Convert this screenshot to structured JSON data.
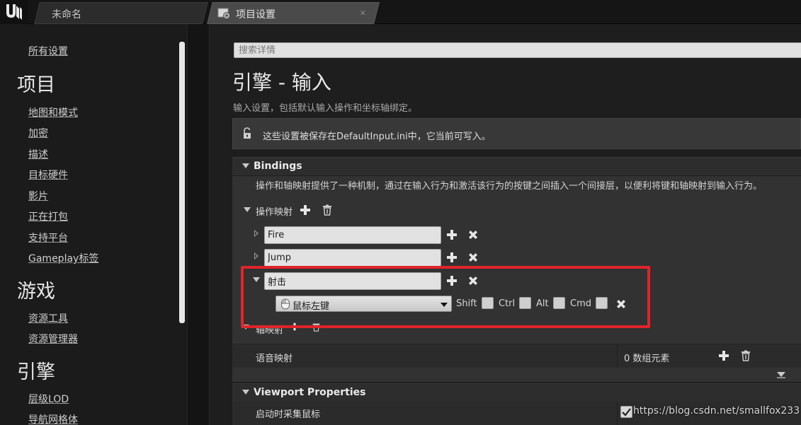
{
  "tabs": {
    "untitled": "未命名",
    "settings": "项目设置"
  },
  "nav": {
    "all_settings": "所有设置",
    "project_head": "项目",
    "project_items": [
      "地图和模式",
      "加密",
      "描述",
      "目标硬件",
      "影片",
      "正在打包",
      "支持平台",
      "Gameplay标签"
    ],
    "game_head": "游戏",
    "game_items": [
      "资源工具",
      "资源管理器"
    ],
    "engine_head": "引擎",
    "engine_items": [
      "层级LOD",
      "导航网格体"
    ]
  },
  "search": {
    "placeholder": "搜索详情"
  },
  "page": {
    "title": "引擎 - 输入",
    "description": "输入设置，包括默认输入操作和坐标轴绑定。",
    "notice": "这些设置被保存在DefaultInput.ini中，它当前可写入。"
  },
  "bindings": {
    "title": "Bindings",
    "description": "操作和轴映射提供了一种机制，通过在输入行为和激活该行为的按键之间插入一个间接层，以便利将键和轴映射到输入行为。",
    "action_mappings_label": "操作映射",
    "actions": [
      "Fire",
      "Jump",
      "射击"
    ],
    "key": "鼠标左键",
    "modifiers": [
      "Shift",
      "Ctrl",
      "Alt",
      "Cmd"
    ],
    "axis_mappings_label": "轴映射",
    "voice_label": "语音映射",
    "voice_value": "0 数组元素"
  },
  "viewport": {
    "title": "Viewport Properties",
    "capture_label": "启动时采集鼠标"
  },
  "watermark": "https://blog.csdn.net/smallfox233",
  "colors": {
    "highlight": "#e0242a",
    "panel": "#323232",
    "field": "#e2e2e2"
  }
}
